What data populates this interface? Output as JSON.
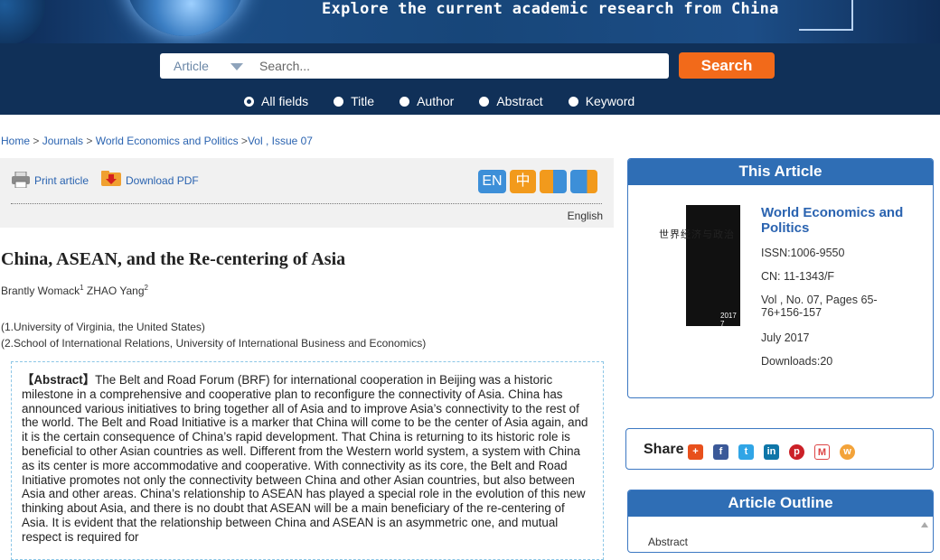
{
  "banner": {
    "tagline": "Explore the current academic research from China"
  },
  "search": {
    "scope": "Article",
    "placeholder": "Search...",
    "button": "Search",
    "options": [
      "All fields",
      "Title",
      "Author",
      "Abstract",
      "Keyword"
    ],
    "selected": "All fields"
  },
  "breadcrumb": {
    "home": "Home",
    "sep1": " > ",
    "journals": "Journals",
    "sep2": " > ",
    "journal": "World Economics and Politics",
    "sep3": " >",
    "issue": "Vol , Issue 07"
  },
  "toolbar": {
    "print": "Print article",
    "download": "Download PDF",
    "lang_en": "EN",
    "lang_zh": "中",
    "language": "English"
  },
  "article": {
    "title": "China, ASEAN, and the Re-centering of Asia",
    "author1": "Brantly Womack",
    "author1_sup": "1",
    "author2": " ZHAO Yang",
    "author2_sup": "2",
    "affil1": "(1.University of Virginia, the United States)",
    "affil2": "(2.School of International Relations, University of International Business and Economics)",
    "abstract_label": "【Abstract】",
    "abstract_text": "The Belt and Road Forum (BRF) for international cooperation in Beijing was a historic milestone in a comprehensive and cooperative plan to reconfigure the connectivity of Asia. China has announced various initiatives to bring together all of Asia and to improve Asia’s connectivity to the rest of the world. The Belt and Road Initiative is a marker that China will come to be the center of Asia again, and it is the certain consequence of China’s rapid development. That China is returning to its historic role is beneficial to other Asian countries as well. Different from the Western world system, a system with China as its center is more accommodative and cooperative. With connectivity as its core, the Belt and Road Initiative promotes not only the connectivity between China and other Asian countries, but also between Asia and other areas. China’s relationship to ASEAN has played a special role in the evolution of this new thinking about Asia, and there is no doubt that ASEAN will be a main beneficiary of the re-centering of Asia. It is evident that the relationship between China and ASEAN is an asymmetric one, and mutual respect is required for"
  },
  "this_article": {
    "header": "This Article",
    "journal": "World Economics and Politics",
    "issn": "ISSN:1006-9550",
    "cn": "CN: 11-1343/F",
    "pages": "Vol , No. 07, Pages 65-76+156-157",
    "date": "July 2017",
    "downloads": "Downloads:20",
    "cover_name": "世界经济与政治",
    "cover_year": "2017 7"
  },
  "share": {
    "label": "Share"
  },
  "outline": {
    "header": "Article Outline",
    "first": "Abstract"
  },
  "colors": {
    "accent": "#f26a1a",
    "navy": "#103058",
    "link": "#2a63b0",
    "panel": "#2f6eb5"
  }
}
